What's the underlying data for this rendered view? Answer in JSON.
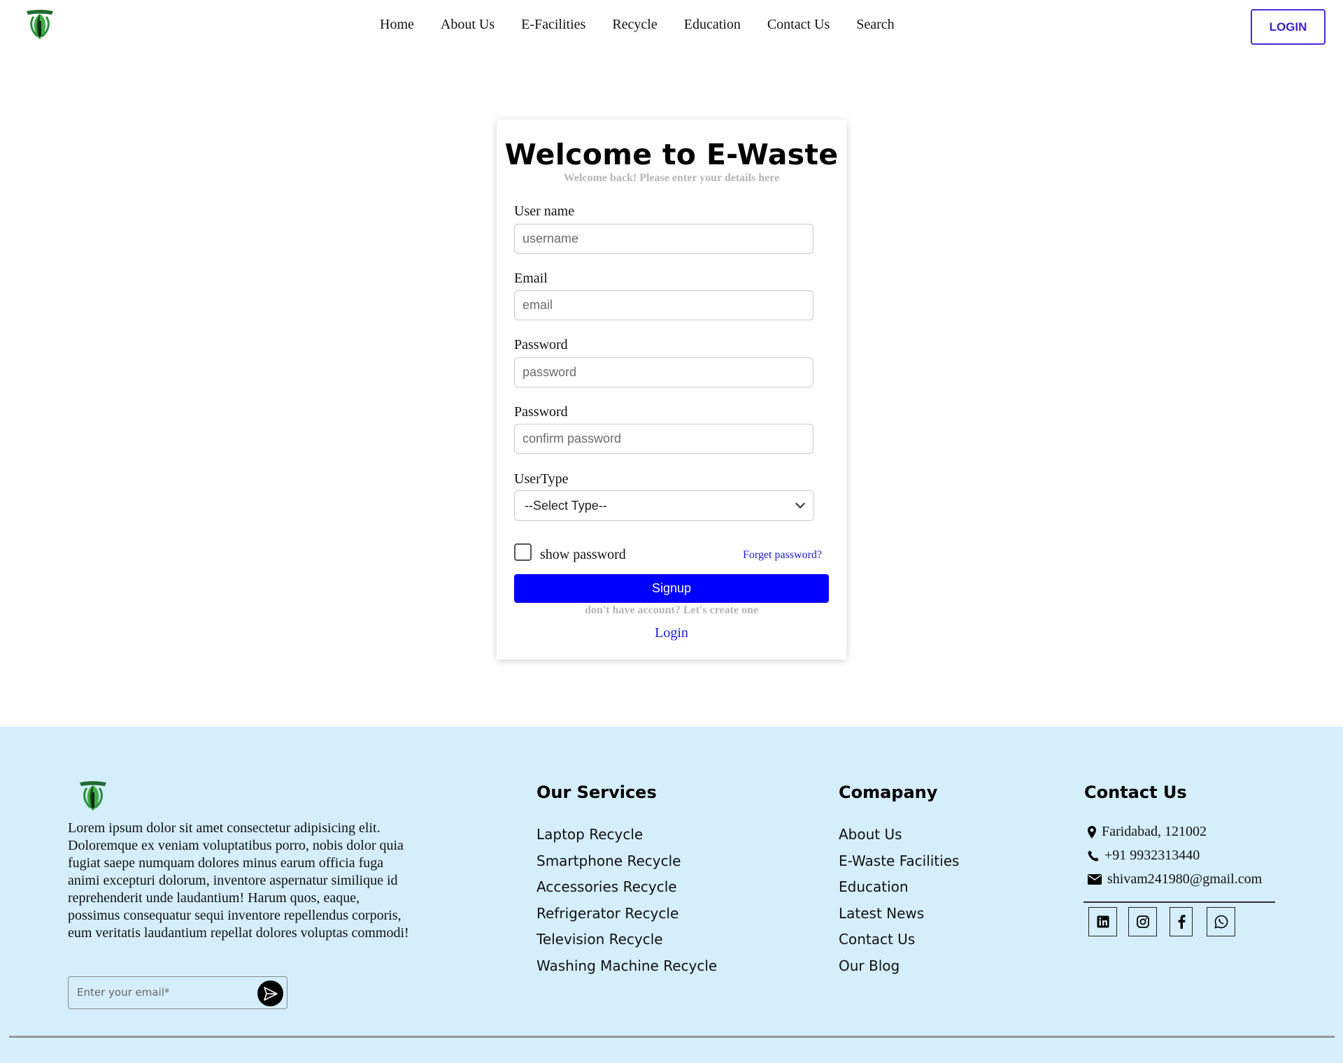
{
  "header": {
    "nav": [
      "Home",
      "About Us",
      "E-Facilities",
      "Recycle",
      "Education",
      "Contact Us",
      "Search"
    ],
    "login_label": "LOGIN"
  },
  "form": {
    "title": "Welcome to E-Waste",
    "subtitle": "Welcome back! Please enter your details here",
    "username_label": "User name",
    "username_placeholder": "username",
    "email_label": "Email",
    "email_placeholder": "email",
    "password_label": "Password",
    "password_placeholder": "password",
    "confirm_label": "Password",
    "confirm_placeholder": "confirm password",
    "usertype_label": "UserType",
    "usertype_selected": "--Select Type--",
    "show_password_label": "show password",
    "show_password_checked": false,
    "forget_label": "Forget password?",
    "signup_label": "Signup",
    "no_account_text": "don't have account? Let's create one",
    "login_link": "Login"
  },
  "footer": {
    "about_text": "Lorem ipsum dolor sit amet consectetur adipisicing elit. Doloremque ex veniam voluptatibus porro, nobis dolor quia fugiat saepe numquam dolores minus earum officia fuga animi excepturi dolorum, inventore aspernatur similique id reprehenderit unde laudantium! Harum quos, eaque, possimus consequatur sequi inventore repellendus corporis, eum veritatis laudantium repellat dolores voluptas commodi!",
    "newsletter_placeholder": "Enter your email*",
    "services_title": "Our Services",
    "services": [
      "Laptop Recycle",
      "Smartphone Recycle",
      "Accessories Recycle",
      "Refrigerator Recycle",
      "Television Recycle",
      "Washing Machine Recycle"
    ],
    "company_title": "Comapany",
    "company": [
      "About Us",
      "E-Waste Facilities",
      "Education",
      "Latest News",
      "Contact Us",
      "Our Blog"
    ],
    "contact_title": "Contact Us",
    "address": "Faridabad, 121002",
    "phone": "+91 9932313440",
    "email": "shivam241980@gmail.com",
    "social_icons": [
      "linkedin-icon",
      "instagram-icon",
      "facebook-icon",
      "whatsapp-icon"
    ]
  },
  "colors": {
    "primary_button": "#0000ff",
    "login_border": "#4b2bd6",
    "footer_bg": "#d4eefb",
    "link": "#1a1ad6",
    "muted_text": "#b5b5b5"
  }
}
